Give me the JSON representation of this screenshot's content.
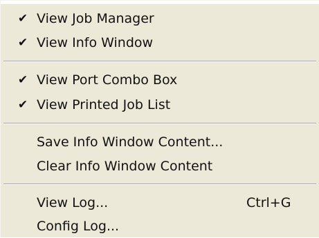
{
  "menu": {
    "groups": [
      {
        "items": [
          {
            "label": "View Job Manager",
            "checked": true,
            "check_glyph": "✔"
          },
          {
            "label": "View Info Window",
            "checked": true,
            "check_glyph": "✔"
          }
        ]
      },
      {
        "items": [
          {
            "label": "View Port Combo Box",
            "checked": true,
            "check_glyph": "✔"
          },
          {
            "label": "View Printed Job List",
            "checked": true,
            "check_glyph": "✔"
          }
        ]
      },
      {
        "items": [
          {
            "label": "Save Info Window Content...",
            "checked": false
          },
          {
            "label": "Clear Info Window Content",
            "checked": false
          }
        ]
      },
      {
        "items": [
          {
            "label": "View Log...",
            "checked": false,
            "shortcut": "Ctrl+G"
          },
          {
            "label": "Config Log...",
            "checked": false
          }
        ]
      }
    ],
    "colors": {
      "background": "#ece9d8",
      "text": "#111111",
      "separator_dark": "#a7a6aa",
      "separator_light": "#ffffff"
    },
    "icons": {
      "check": "check-icon"
    }
  }
}
